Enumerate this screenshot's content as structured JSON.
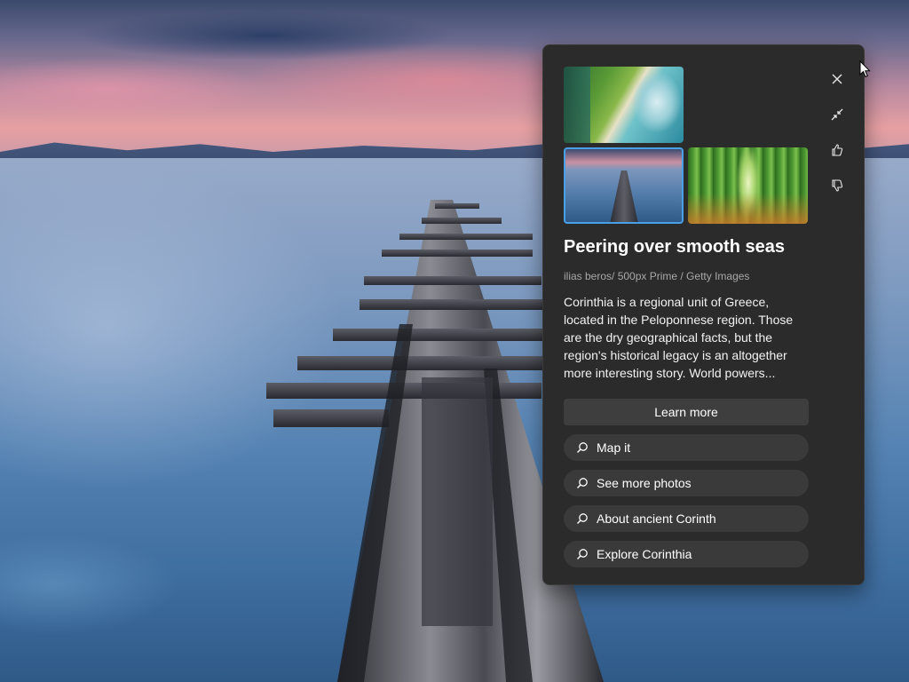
{
  "panel": {
    "title": "Peering over smooth seas",
    "credit": "ilias beros/ 500px Prime / Getty Images",
    "description": "Corinthia is a regional unit of Greece, located in the Peloponnese region. Those are the dry geographical facts, but the region's historical legacy is an altogether more interesting story. World powers...",
    "learn_more_label": "Learn more",
    "searches": [
      {
        "label": "Map it",
        "icon": "search-icon"
      },
      {
        "label": "See more photos",
        "icon": "search-icon"
      },
      {
        "label": "About ancient Corinth",
        "icon": "search-icon"
      },
      {
        "label": "Explore Corinthia",
        "icon": "search-icon"
      }
    ],
    "thumbnails": [
      {
        "subject": "tropical beach cliffs",
        "selected": false
      },
      {
        "subject": "pier over sea",
        "selected": true
      },
      {
        "subject": "bamboo forest path",
        "selected": false
      }
    ],
    "side_actions": [
      "close-icon",
      "collapse-icon",
      "thumbs-up-icon",
      "thumbs-down-icon"
    ],
    "accent_color": "#4aa0e6"
  },
  "wallpaper": {
    "subject": "wooden pier over calm sea at sunset"
  }
}
